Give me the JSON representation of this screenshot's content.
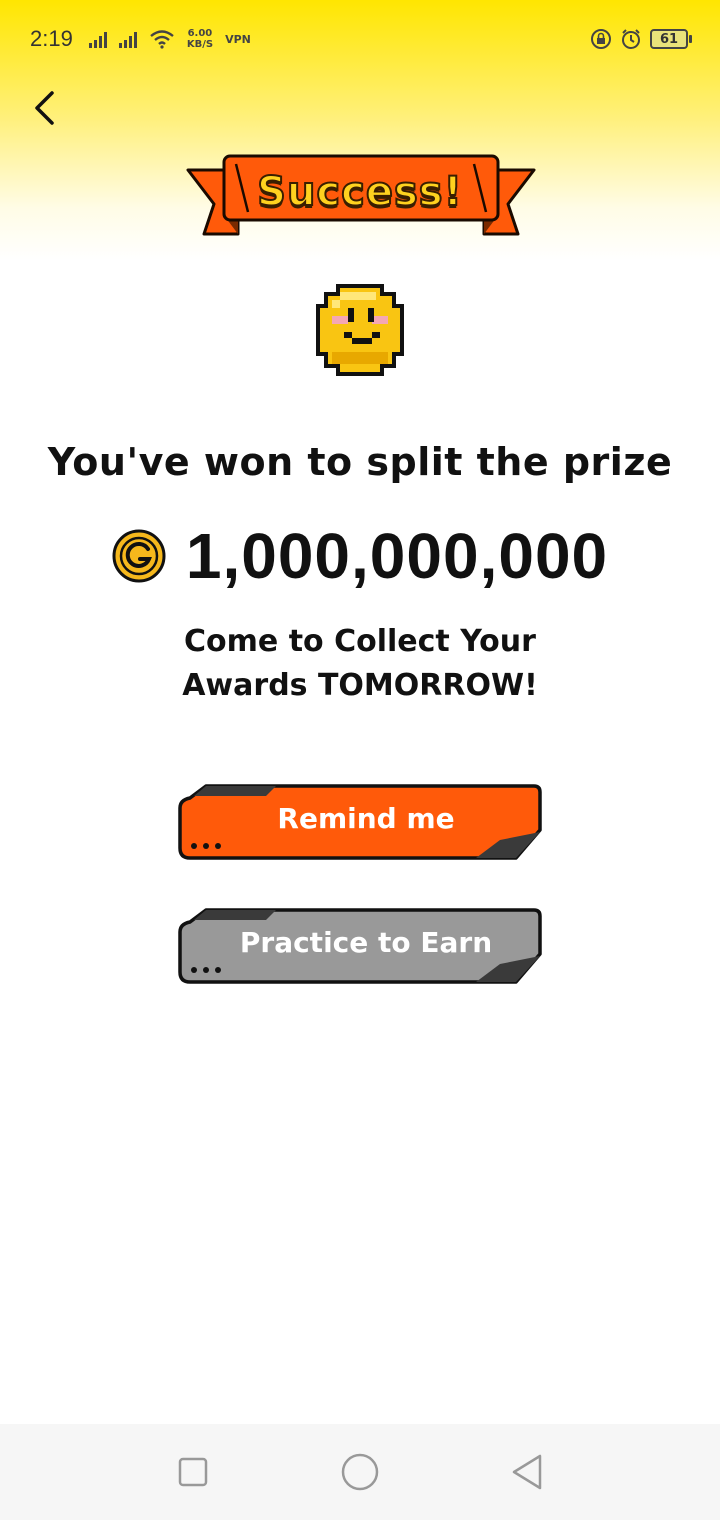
{
  "status_bar": {
    "time": "2:19",
    "speed_value": "6.00",
    "speed_unit": "KB/S",
    "vpn": "VPN",
    "battery": "61"
  },
  "banner": {
    "title": "Success!"
  },
  "headline": "You've won to split the prize",
  "prize": {
    "amount": "1,000,000,000",
    "coin_icon": "gold-coin-icon"
  },
  "collect": {
    "line1": "Come to Collect Your",
    "line2": "Awards TOMORROW!"
  },
  "buttons": {
    "remind_label": "Remind me",
    "practice_label": "Practice to Earn"
  },
  "colors": {
    "accent_orange": "#ff5a0a",
    "gray_button": "#999999",
    "yellow": "#ffe600",
    "coin_gold": "#f6b81c"
  }
}
